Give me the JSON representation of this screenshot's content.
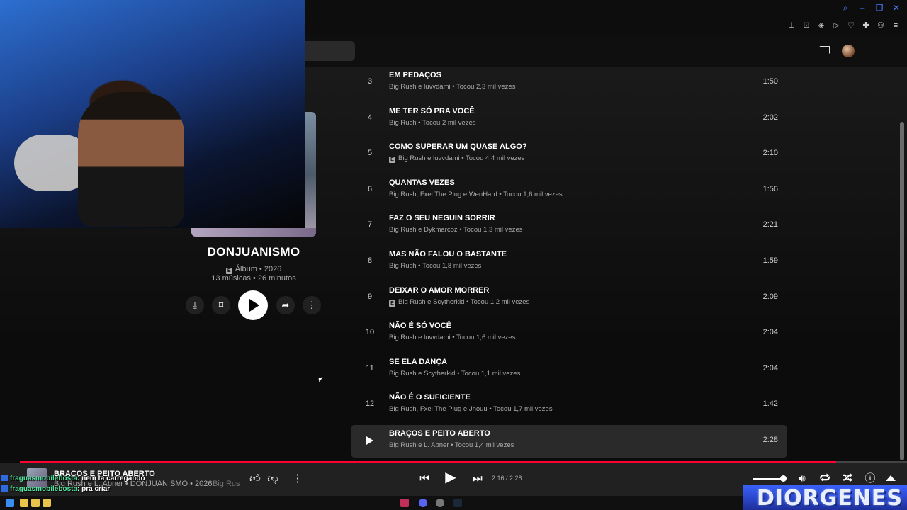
{
  "album": {
    "title": "DONJUANISMO",
    "type_year": "Álbum • 2026",
    "stats": "13 músicas • 26 minutos",
    "explicit_badge": "E"
  },
  "tracks": [
    {
      "num": "3",
      "title": "EM PEDAÇOS",
      "artist": "Big Rush e luvvdami • Tocou 2,3 mil vezes",
      "duration": "1:50",
      "explicit": false
    },
    {
      "num": "4",
      "title": "ME TER SÓ PRA VOCÊ",
      "artist": "Big Rush • Tocou 2 mil vezes",
      "duration": "2:02",
      "explicit": false
    },
    {
      "num": "5",
      "title": "COMO SUPERAR UM QUASE ALGO?",
      "artist": "Big Rush e luvvdami • Tocou 4,4 mil vezes",
      "duration": "2:10",
      "explicit": true
    },
    {
      "num": "6",
      "title": "QUANTAS VEZES",
      "artist": "Big Rush, Fxel The Plug e WenHard • Tocou 1,6 mil vezes",
      "duration": "1:56",
      "explicit": false
    },
    {
      "num": "7",
      "title": "FAZ O SEU NEGUIN SORRIR",
      "artist": "Big Rush e Dykmarcoz • Tocou 1,3 mil vezes",
      "duration": "2:21",
      "explicit": false
    },
    {
      "num": "8",
      "title": "MAS NÃO FALOU O BASTANTE",
      "artist": "Big Rush • Tocou 1,8 mil vezes",
      "duration": "1:59",
      "explicit": false
    },
    {
      "num": "9",
      "title": "DEIXAR O AMOR MORRER",
      "artist": "Big Rush e Scytherkid • Tocou 1,2 mil vezes",
      "duration": "2:09",
      "explicit": true
    },
    {
      "num": "10",
      "title": "NÃO É SÓ VOCÊ",
      "artist": "Big Rush e luvvdami • Tocou 1,6 mil vezes",
      "duration": "2:04",
      "explicit": false
    },
    {
      "num": "11",
      "title": "SE ELA DANÇA",
      "artist": "Big Rush e Scytherkid • Tocou 1,1 mil vezes",
      "duration": "2:04",
      "explicit": false
    },
    {
      "num": "12",
      "title": "NÃO É O SUFICIENTE",
      "artist": "Big Rush, Fxel The Plug e Jhouu • Tocou 1,7 mil vezes",
      "duration": "1:42",
      "explicit": false
    },
    {
      "num": "",
      "title": "BRAÇOS E PEITO ABERTO",
      "artist": "Big Rush e L. Abner • Tocou 1,4 mil vezes",
      "duration": "2:28",
      "explicit": false
    }
  ],
  "player": {
    "title": "BRAÇOS E PEITO ABERTO",
    "subtitle": "Big Rush e L. Abner • DONJUANISMO • 2026",
    "subtitle_extra": "Big Rus",
    "time": "2:16 / 2:28",
    "progress_fraction": 0.92,
    "volume_fraction": 0.85
  },
  "chat": [
    {
      "user": "fraguasmobilebosta",
      "msg": ": nem ta carregando"
    },
    {
      "user": "fraguasmobilebosta",
      "msg": ": pra criar"
    }
  ],
  "brand": {
    "text": "DIORGENES"
  },
  "colors": {
    "accent": "#ff0033",
    "chat_user": "#4fe6a0",
    "brand_blue": "#3b62ff"
  },
  "icons": {
    "download": "download-icon",
    "save": "bookmark-icon",
    "share": "share-icon",
    "more": "more-vert-icon",
    "cast": "cast-icon"
  }
}
